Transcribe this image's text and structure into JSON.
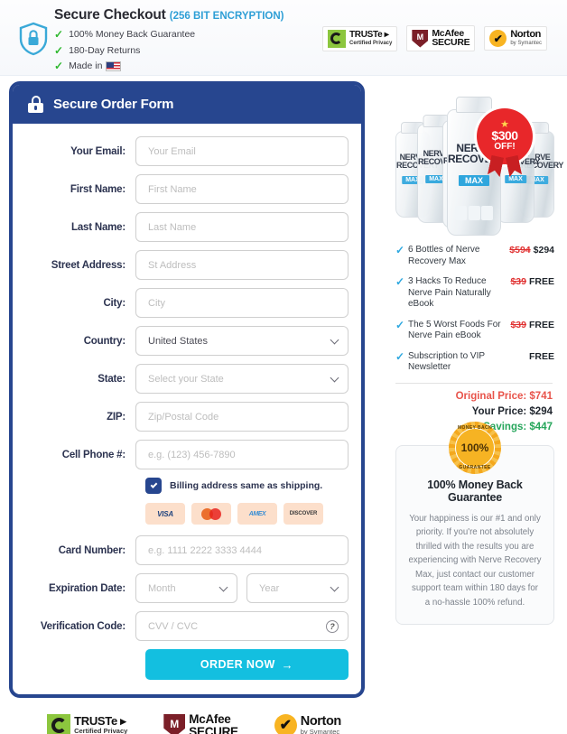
{
  "topbar": {
    "shield_icon": "shield-lock-icon",
    "title": "Secure Checkout",
    "encryption": "(256 BIT ENCRYPTION)",
    "trust_points": [
      "100% Money Back Guarantee",
      "180-Day Returns",
      "Made in"
    ],
    "flag_icon": "us-flag-icon"
  },
  "trust_badges": [
    {
      "name": "TRUSTe",
      "line1": "TRUSTe ▸",
      "line2": "Certified Privacy",
      "icon": "truste-icon"
    },
    {
      "name": "McAfee SECURE",
      "line1": "McAfee",
      "line2": "SECURE",
      "icon": "mcafee-shield-icon",
      "mark": "M"
    },
    {
      "name": "Norton",
      "line1": "Norton",
      "line2": "by Symantec",
      "icon": "norton-check-icon",
      "mark": "✔"
    }
  ],
  "form": {
    "header_title": "Secure Order Form",
    "lock_icon": "lock-icon",
    "fields": [
      {
        "label": "Your Email:",
        "placeholder": "Your Email",
        "value": "",
        "type": "text",
        "name": "email-field"
      },
      {
        "label": "First Name:",
        "placeholder": "First Name",
        "value": "",
        "type": "text",
        "name": "first-name-field"
      },
      {
        "label": "Last Name:",
        "placeholder": "Last Name",
        "value": "",
        "type": "text",
        "name": "last-name-field"
      },
      {
        "label": "Street Address:",
        "placeholder": "St Address",
        "value": "",
        "type": "text",
        "name": "street-address-field"
      },
      {
        "label": "City:",
        "placeholder": "City",
        "value": "",
        "type": "text",
        "name": "city-field"
      },
      {
        "label": "Country:",
        "placeholder": "",
        "value": "United States",
        "type": "select",
        "name": "country-select"
      },
      {
        "label": "State:",
        "placeholder": "Select your State",
        "value": "",
        "type": "select",
        "name": "state-select"
      },
      {
        "label": "ZIP:",
        "placeholder": "Zip/Postal Code",
        "value": "",
        "type": "text",
        "name": "zip-field"
      },
      {
        "label": "Cell Phone #:",
        "placeholder": "e.g. (123) 456-7890",
        "value": "",
        "type": "text",
        "name": "cell-phone-field"
      }
    ],
    "billing_checkbox": {
      "label": "Billing address same as shipping.",
      "checked": true
    },
    "card_brands": [
      {
        "name": "visa",
        "label": "VISA"
      },
      {
        "name": "mastercard",
        "label": ""
      },
      {
        "name": "amex",
        "label": "AMEX"
      },
      {
        "name": "discover",
        "label": "DISCOVER"
      }
    ],
    "card_number": {
      "label": "Card Number:",
      "placeholder": "e.g. 1111 2222 3333 4444",
      "value": ""
    },
    "expiration": {
      "label": "Expiration Date:",
      "month_placeholder": "Month",
      "year_placeholder": "Year"
    },
    "verification": {
      "label": "Verification Code:",
      "placeholder": "CVV / CVC",
      "value": "",
      "help_icon": "question-mark-icon"
    },
    "submit_label": "ORDER NOW",
    "submit_arrow": "→"
  },
  "product": {
    "image_alt": "six-bottles-nerve-recovery-max",
    "bottle_name_line1": "NERVE",
    "bottle_name_line2": "RECOVERY",
    "bottle_badge": "MAX",
    "discount_badge": {
      "star": "★",
      "amount": "$300",
      "label": "OFF!"
    },
    "items": [
      {
        "text": "6 Bottles of Nerve Recovery Max",
        "old_price": "$594",
        "price": "$294"
      },
      {
        "text": "3 Hacks To Reduce Nerve Pain Naturally eBook",
        "old_price": "$39",
        "price": "FREE"
      },
      {
        "text": "The 5 Worst Foods For Nerve Pain eBook",
        "old_price": "$39",
        "price": "FREE"
      },
      {
        "text": "Subscription to VIP Newsletter",
        "old_price": "",
        "price": "FREE"
      }
    ],
    "totals": {
      "original_label": "Original Price:",
      "original_value": "$741",
      "your_label": "Your Price:",
      "your_value": "$294",
      "savings_label": "Savings:",
      "savings_value": "$447"
    }
  },
  "guarantee": {
    "seal": {
      "arc_top": "MONEY BACK",
      "percent": "100%",
      "arc_bottom": "GUARANTEE",
      "icon": "money-back-seal-icon"
    },
    "title": "100% Money Back Guarantee",
    "text": "Your happiness is our #1 and only priority. If you're not absolutely thrilled with the results you are experiencing with Nerve Recovery Max, just contact our customer support team within 180 days for a no-hassle 100% refund."
  },
  "colors": {
    "navy": "#27468f",
    "cyan": "#13bfe0",
    "red": "#e8272a",
    "green": "#26a65b",
    "orange_seal": "#f6b323",
    "accent_blue": "#2f9fd6"
  }
}
